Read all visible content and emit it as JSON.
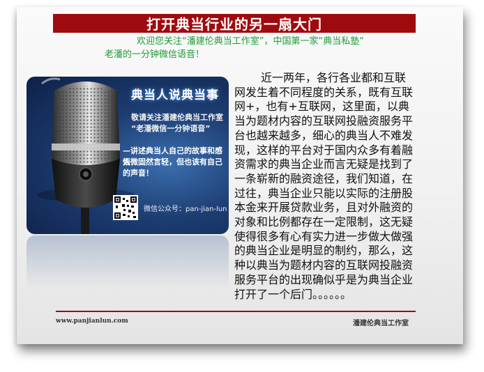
{
  "header": {
    "title": "打开典当行业的另一扇大门",
    "welcome_line1": "欢迎您关注“潘建伦典当工作室”，中国第一家“典当私塾“",
    "welcome_line2": "老潘的一分钟微信语音！"
  },
  "poster": {
    "title": "典当人说典当事",
    "subtitle1": "敬请关注潘建伦典当工作室",
    "subtitle2": "“老潘微信一分钟语音”",
    "line1": "—讲述典当人自己的故事和感悟",
    "line2": "人微固然言轻，但也该有自己的声音！",
    "wechat": "微信公众号：pan-jian-lun",
    "icons": [
      "microphone-icon",
      "qr-code-icon"
    ]
  },
  "article": {
    "lines": [
      "近一两年，各行各业都和互联",
      "网发生着不同程度的关系，既有互联",
      "网+，也有+互联网，这里面，以典",
      "当为题材内容的互联网投融资服务平",
      "台也越来越多，细心的典当人不难发",
      "现，这样的平台对于国内众多有着融",
      "资需求的典当企业而言无疑是找到了",
      "一条崭新的融资途径，我们知道，在",
      "过往，典当企业只能以实际的注册股",
      "本金来开展贷款业务，且对外融资的",
      "对象和比例都存在一定限制，这无疑",
      "使得很多有心有实力进一步做大做强",
      "的典当企业是明显的制约，那么，这",
      "种以典当为题材内容的互联网投融资",
      "服务平台的出现确似乎是为典当企业",
      "打开了一个后门。。。。。。"
    ]
  },
  "footer": {
    "website": "www.panjianlun.com",
    "studio": "潘建伦典当工作室"
  },
  "colors": {
    "title_bar": "#9e0b0f",
    "welcome_text": "#1f9a3a",
    "poster_bg": "#1d3d72"
  }
}
